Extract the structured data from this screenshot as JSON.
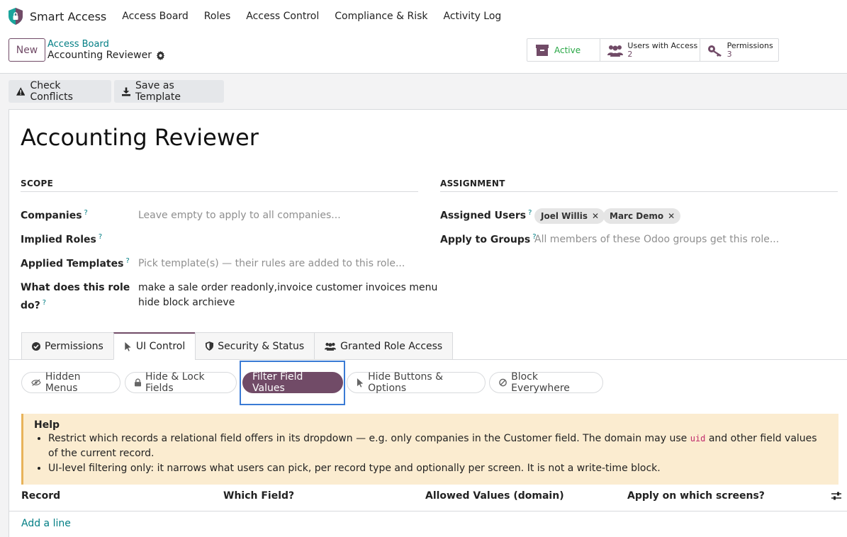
{
  "app": {
    "name": "Smart Access",
    "nav": [
      "Access Board",
      "Roles",
      "Access Control",
      "Compliance & Risk",
      "Activity Log"
    ]
  },
  "control_panel": {
    "new_label": "New",
    "breadcrumb_parent": "Access Board",
    "breadcrumb_current": "Accounting Reviewer",
    "stats": {
      "active_label": "Active",
      "users_label": "Users with Access",
      "users_count": "2",
      "permissions_label": "Permissions",
      "permissions_count": "3"
    }
  },
  "actions": {
    "check_conflicts": "Check Conflicts",
    "save_template": "Save as Template"
  },
  "form": {
    "title": "Accounting Reviewer",
    "scope": {
      "heading": "SCOPE",
      "companies_label": "Companies",
      "companies_placeholder": "Leave empty to apply to all companies...",
      "implied_roles_label": "Implied Roles",
      "applied_templates_label": "Applied Templates",
      "applied_templates_placeholder": "Pick template(s) — their rules are added to this role...",
      "what_label_1": "What does this role",
      "what_label_2": "do?",
      "what_value_1": "make a sale order readonly,invoice customer invoices menu",
      "what_value_2": "hide block archieve"
    },
    "assignment": {
      "heading": "ASSIGNMENT",
      "assigned_users_label": "Assigned Users",
      "users": [
        "Joel Willis",
        "Marc Demo"
      ],
      "apply_groups_label": "Apply to Groups",
      "apply_groups_placeholder": "All members of these Odoo groups get this role..."
    },
    "help_marker": "?",
    "remove_glyph": "✕"
  },
  "tabs": [
    "Permissions",
    "UI Control",
    "Security & Status",
    "Granted Role Access"
  ],
  "subtabs": [
    "Hidden Menus",
    "Hide & Lock Fields",
    "Filter Field Values",
    "Hide Buttons & Options",
    "Block Everywhere"
  ],
  "help": {
    "title": "Help",
    "b1_part1": "Restrict which records a relational field offers in its dropdown — e.g. only companies in the Customer field. The domain may use ",
    "b1_code": "uid",
    "b1_part2": " and other field values of the current record.",
    "b2": "UI-level filtering only: it narrows what users can pick, per record type and optionally per screen. It is not a write-time block."
  },
  "table": {
    "headers": [
      "Record",
      "Which Field?",
      "Allowed Values (domain)",
      "Apply on which screens?"
    ],
    "add_line": "Add a line"
  },
  "colors": {
    "brand": "#714b67",
    "link": "#017e84",
    "active": "#28a745",
    "focus": "#3a7bd5"
  }
}
